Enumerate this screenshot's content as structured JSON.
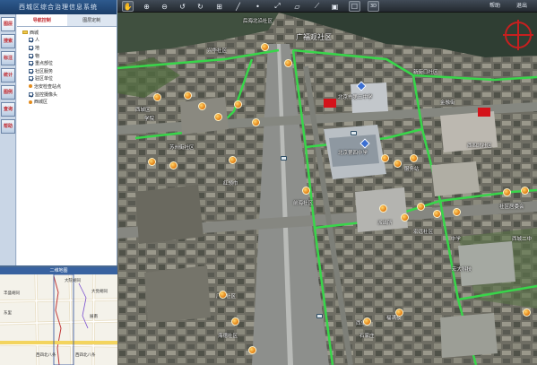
{
  "app": {
    "title": "西城区综合治理信息系统"
  },
  "left_tabs": [
    "图层",
    "搜索",
    "标注",
    "统计",
    "图例",
    "查询",
    "帮助"
  ],
  "tree_tabs": [
    "导航控制",
    "图层定制"
  ],
  "tree": [
    {
      "label": "西城",
      "type": "folder"
    },
    {
      "label": "人",
      "type": "check"
    },
    {
      "label": "地",
      "type": "check"
    },
    {
      "label": "物",
      "type": "check"
    },
    {
      "label": "重点部位",
      "type": "check"
    },
    {
      "label": "社区服务",
      "type": "check"
    },
    {
      "label": "驻区单位",
      "type": "check"
    },
    {
      "label": "治安检查站点",
      "type": "poi"
    },
    {
      "label": "监控摄像头",
      "type": "check"
    },
    {
      "label": "西城区",
      "type": "poi"
    }
  ],
  "minimap": {
    "title": "二维地图",
    "labels": [
      "丰盛胡同",
      "大院胡同",
      "东里",
      "展南",
      "大觉胡同",
      "西四北八条",
      "西四北八条"
    ]
  },
  "toolbar": {
    "buttons": [
      "pan-icon",
      "zoom-in-icon",
      "zoom-out-icon",
      "rotate-left-icon",
      "rotate-right-icon",
      "measure-icon",
      "line-icon",
      "point-icon",
      "distance-icon",
      "area-icon",
      "tilt-icon",
      "select-icon",
      "clear-icon",
      "full-icon"
    ],
    "right": [
      "帮助",
      "退出"
    ]
  },
  "map_labels": [
    {
      "text": "广福观社区",
      "style": "big"
    },
    {
      "text": "后海北沿社区",
      "style": "small"
    },
    {
      "text": "兴华社区",
      "style": "small"
    },
    {
      "text": "新街口社区",
      "style": "small"
    },
    {
      "text": "西四北社区",
      "style": "small"
    },
    {
      "text": "苏州街社区",
      "style": "small"
    },
    {
      "text": "北京市第三中学",
      "style": "small"
    },
    {
      "text": "北京第四中学",
      "style": "small"
    },
    {
      "text": "宏大科技",
      "style": "small"
    },
    {
      "text": "西城区",
      "style": "small"
    },
    {
      "text": "前海社区",
      "style": "small"
    },
    {
      "text": "服务站",
      "style": "small"
    },
    {
      "text": "社区居委会",
      "style": "small"
    },
    {
      "text": "派出所",
      "style": "small"
    },
    {
      "text": "石家庄",
      "style": "small"
    },
    {
      "text": "宏远社区",
      "style": "small"
    },
    {
      "text": "福满楼",
      "style": "small"
    },
    {
      "text": "厂甸社区",
      "style": "small"
    },
    {
      "text": "海德社区",
      "style": "small"
    },
    {
      "text": "红领巾",
      "style": "small"
    },
    {
      "text": "金融街",
      "style": "small"
    },
    {
      "text": "学院",
      "style": "small"
    },
    {
      "text": "中学",
      "style": "small"
    },
    {
      "text": "西城二中",
      "style": "small"
    },
    {
      "text": "西单",
      "style": "small"
    }
  ]
}
